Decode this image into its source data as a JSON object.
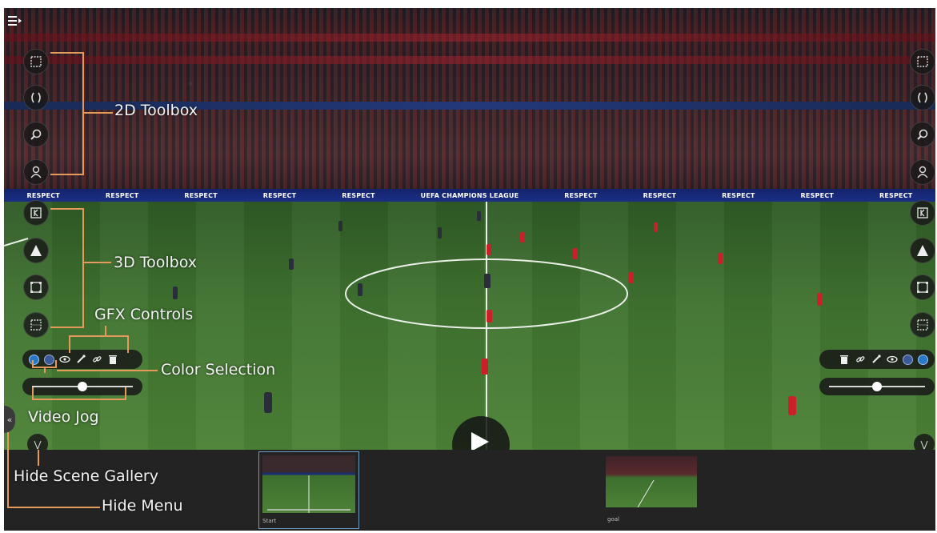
{
  "app": {
    "colors": {
      "accent": "#e39a5a",
      "panel": "#191919",
      "gallery": "#232323",
      "selected_border": "#6e9ac0"
    },
    "menu_icon": "menu-hamburger-icon"
  },
  "stadium": {
    "ad_text": "RESPECT",
    "ad_center": "UEFA CHAMPIONS LEAGUE"
  },
  "toolboxes": {
    "tools_2d": [
      {
        "name": "rectangle-select-icon"
      },
      {
        "name": "bracket-icon"
      },
      {
        "name": "magnifier-icon"
      },
      {
        "name": "person-select-icon"
      }
    ],
    "tools_3d": [
      {
        "name": "keyframe-icon"
      },
      {
        "name": "cone-icon"
      },
      {
        "name": "frame-icon"
      },
      {
        "name": "grid-frame-icon"
      }
    ]
  },
  "gfx_controls": {
    "icons": [
      "eye-icon",
      "eyedropper-icon",
      "link-icon",
      "trash-icon"
    ],
    "colors": [
      "#2a78c8",
      "#3b5a9a"
    ],
    "jog_value": 0.5
  },
  "annotations": {
    "toolbox_2d": "2D Toolbox",
    "toolbox_3d": "3D Toolbox",
    "gfx": "GFX Controls",
    "color_selection": "Color Selection",
    "video_jog": "Video Jog",
    "hide_gallery": "Hide Scene Gallery",
    "hide_menu": "Hide Menu"
  },
  "gallery": {
    "scenes": [
      {
        "caption": "Start",
        "selected": true
      },
      {
        "caption": "goal",
        "selected": false
      }
    ]
  }
}
